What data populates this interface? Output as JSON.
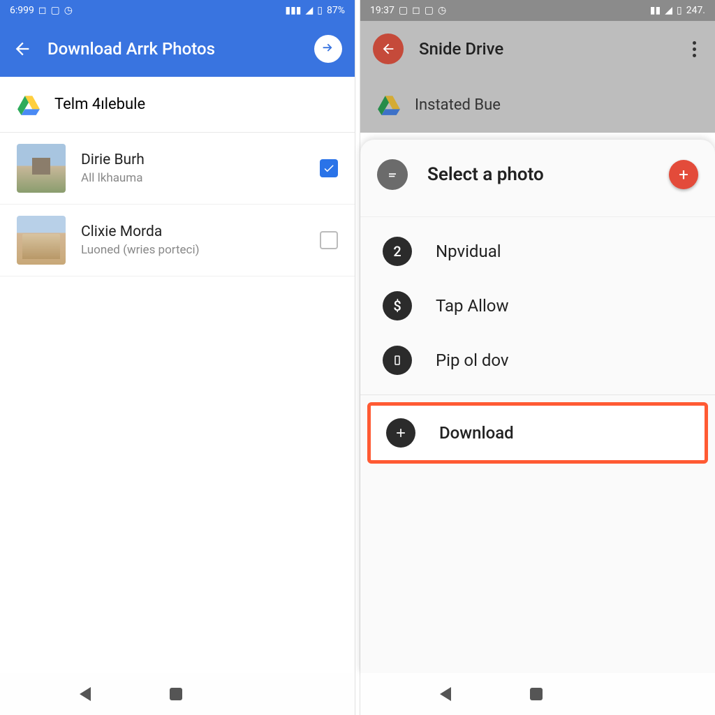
{
  "left": {
    "status": {
      "time": "6:999",
      "battery": "87%"
    },
    "appbar": {
      "title": "Download Arrk Photos"
    },
    "folder": {
      "name": "Telm 4ılebule"
    },
    "files": [
      {
        "title": "Dirie Burh",
        "subtitle": "All lkhauma",
        "checked": true
      },
      {
        "title": "Clixie Morda",
        "subtitle": "Luoned (wries porteci)",
        "checked": false
      }
    ]
  },
  "right": {
    "status": {
      "time": "19:37",
      "battery": "247."
    },
    "appbar": {
      "title": "Snide Drive"
    },
    "folder": {
      "name": "Instated Bue"
    },
    "sheet": {
      "title": "Select a photo",
      "items": [
        {
          "badge": "2",
          "label": "Npvidual"
        },
        {
          "badge": "$",
          "label": "Tap Allow"
        },
        {
          "badge": "0",
          "label": "Pip ol dov"
        }
      ],
      "download": {
        "label": "Download"
      }
    }
  }
}
